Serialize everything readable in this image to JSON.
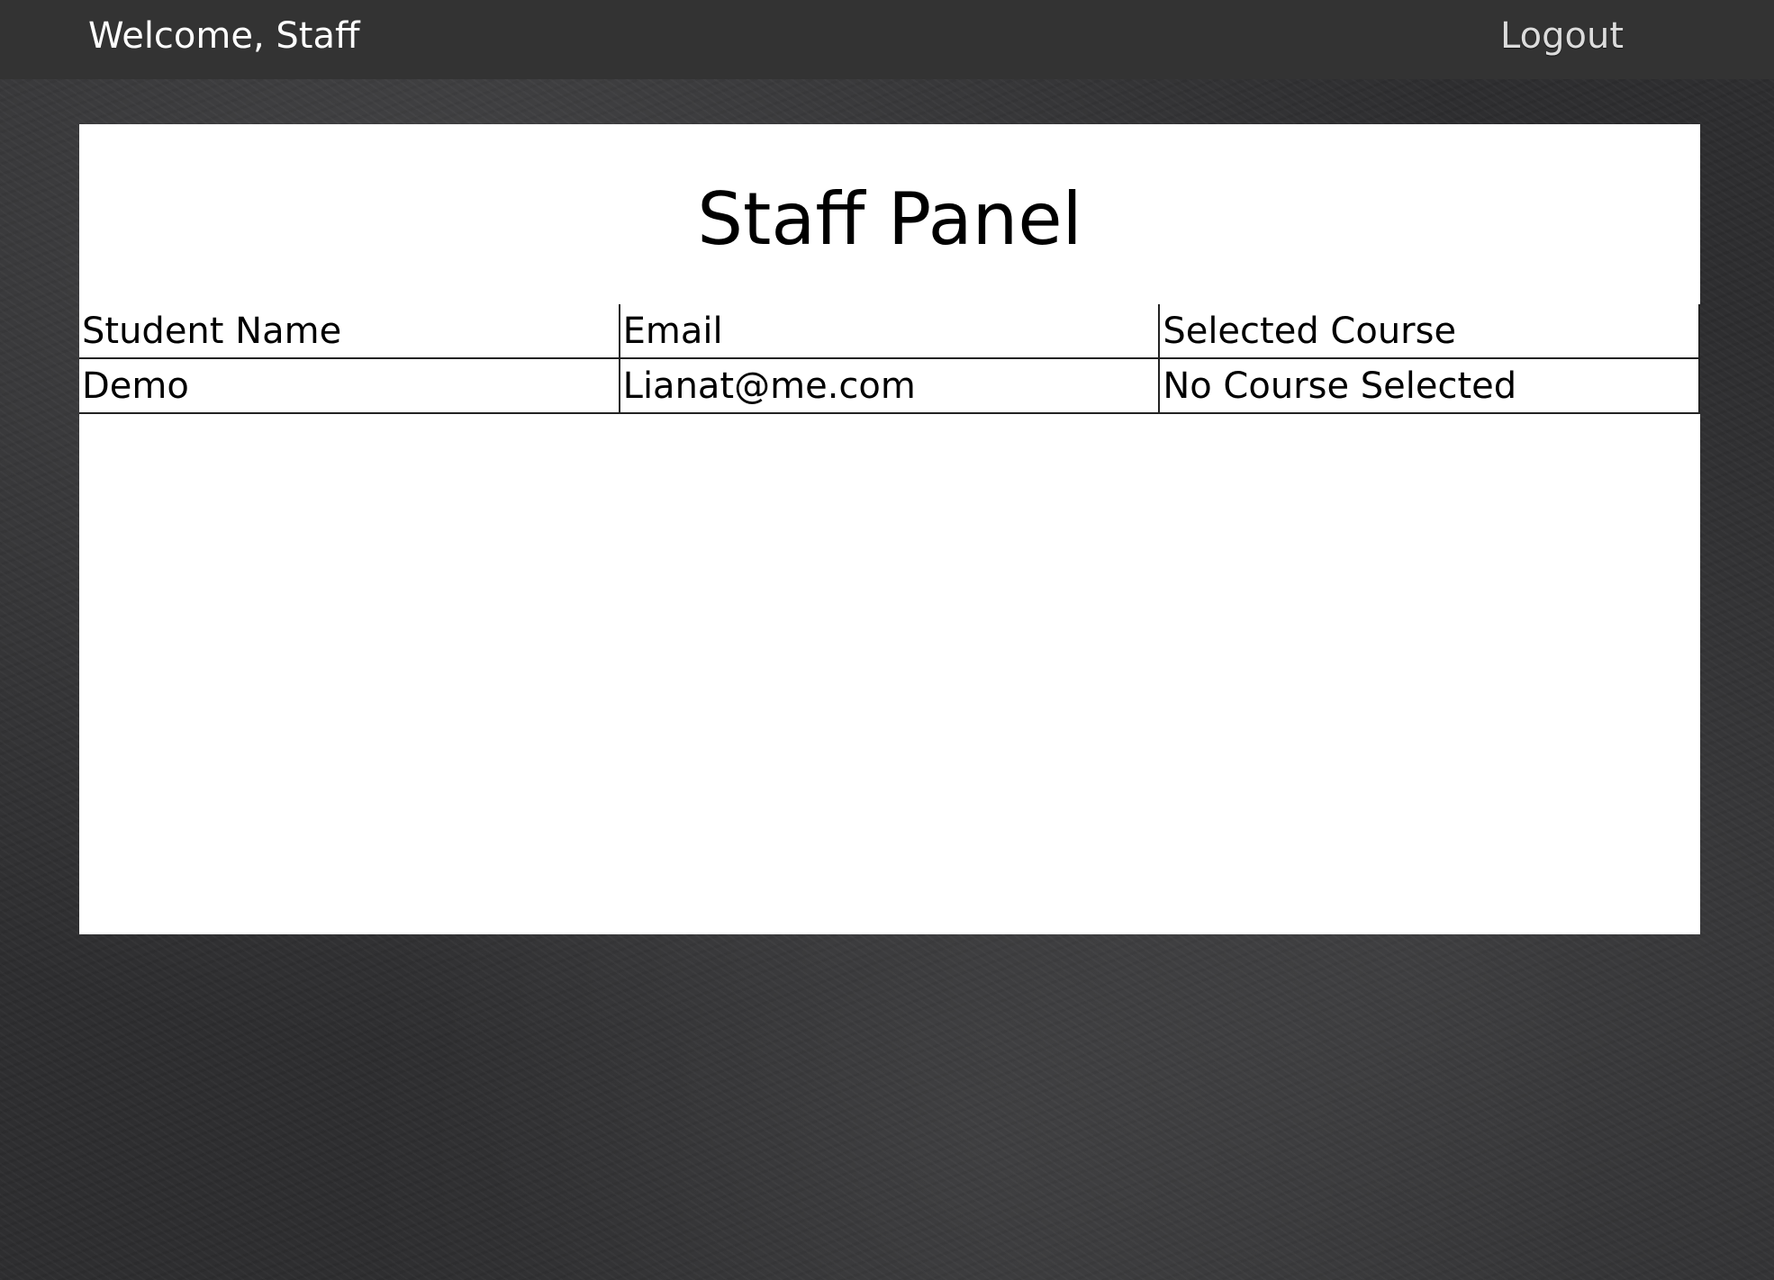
{
  "header": {
    "welcome_text": "Welcome, Staff",
    "logout_label": "Logout"
  },
  "panel": {
    "title": "Staff Panel",
    "table": {
      "columns": [
        "Student Name",
        "Email",
        "Selected Course"
      ],
      "rows": [
        [
          "Demo",
          "Lianat@me.com",
          "No Course Selected"
        ]
      ]
    }
  },
  "colors": {
    "topbar_background": "#333333",
    "page_background": "#2e2e30",
    "panel_background": "#ffffff"
  }
}
